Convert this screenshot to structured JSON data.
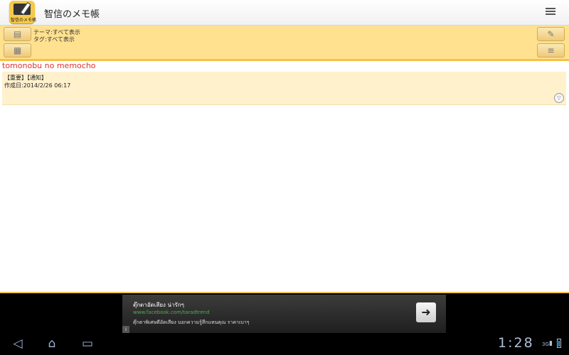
{
  "app": {
    "title": "智信のメモ帳",
    "icon_caption": "智信のメモ帳"
  },
  "filter": {
    "theme": "テーマ:すべて表示",
    "tag": "タグ:すべて表示"
  },
  "account": "tomonobu no memocho",
  "memos": [
    {
      "tags": "【重要】【通知】",
      "created": "作成日:2014/2/26 06:17"
    }
  ],
  "ad": {
    "title": "ตุ๊กตาอัดเสียง น่ารักๆ",
    "url": "www.facebook.com/taradtrend",
    "description": "ตุ๊กตาพิเศษดีอัดเสียง บอกความรู้สึกแทนคุณ ราคาเบาๆ",
    "arrow": "➜",
    "info": "i"
  },
  "status": {
    "time": "1:28",
    "network": "3G"
  },
  "icons": {
    "menu": "menu-icon",
    "theme_filter": "theme-filter-icon",
    "tag_filter": "tag-filter-icon",
    "edit": "pencil-icon",
    "sort": "sort-icon",
    "expand": "expand-icon",
    "back": "back-icon",
    "home": "home-icon",
    "recent": "recent-apps-icon"
  },
  "colors": {
    "filter_bar": "#ffe18f",
    "accent_border": "#f4c24a",
    "memo_bg": "#fff1cc",
    "account_text": "#e0322b"
  }
}
